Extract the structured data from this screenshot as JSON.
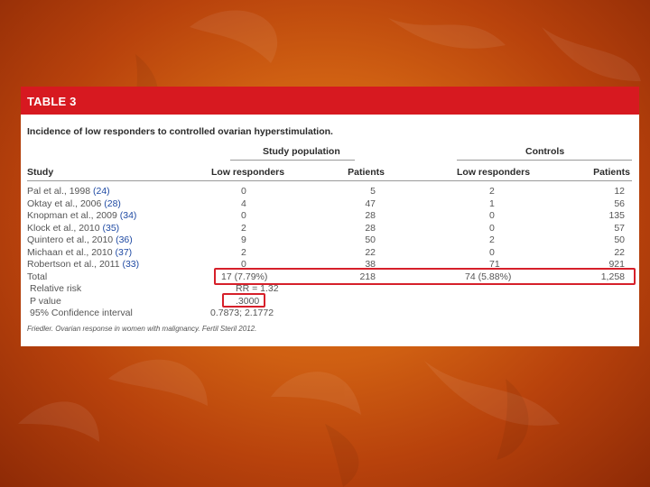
{
  "table": {
    "banner_title": "TABLE 3",
    "caption": "Incidence of low responders to controlled ovarian hyperstimulation.",
    "group_headers": {
      "study_population": "Study population",
      "controls": "Controls"
    },
    "columns": {
      "study": "Study",
      "low_responders": "Low responders",
      "patients": "Patients",
      "controls_low_responders": "Low responders",
      "controls_patients": "Patients"
    },
    "rows": [
      {
        "study": "Pal et al., 1998",
        "ref": "(24)",
        "low_responders": "0",
        "patients": "5",
        "controls_low_responders": "2",
        "controls_patients": "12"
      },
      {
        "study": "Oktay et al., 2006",
        "ref": "(28)",
        "low_responders": "4",
        "patients": "47",
        "controls_low_responders": "1",
        "controls_patients": "56"
      },
      {
        "study": "Knopman et al., 2009",
        "ref": "(34)",
        "low_responders": "0",
        "patients": "28",
        "controls_low_responders": "0",
        "controls_patients": "135"
      },
      {
        "study": "Klock et al., 2010",
        "ref": "(35)",
        "low_responders": "2",
        "patients": "28",
        "controls_low_responders": "0",
        "controls_patients": "57"
      },
      {
        "study": "Quintero et al., 2010",
        "ref": "(36)",
        "low_responders": "9",
        "patients": "50",
        "controls_low_responders": "2",
        "controls_patients": "50"
      },
      {
        "study": "Michaan et al., 2010",
        "ref": "(37)",
        "low_responders": "2",
        "patients": "22",
        "controls_low_responders": "0",
        "controls_patients": "22"
      },
      {
        "study": "Robertson et al., 2011",
        "ref": "(33)",
        "low_responders": "0",
        "patients": "38",
        "controls_low_responders": "71",
        "controls_patients": "921"
      }
    ],
    "total": {
      "label": "Total",
      "low_responders": "17 (7.79%)",
      "patients": "218",
      "controls_low_responders": "74 (5.88%)",
      "controls_patients": "1,258"
    },
    "stats": [
      {
        "label": "Relative risk",
        "value": "RR = 1.32"
      },
      {
        "label": "P value",
        "value": ".3000"
      },
      {
        "label": "95% Confidence interval",
        "value": "0.7873; 2.1772"
      }
    ],
    "footnote": "Friedler. Ovarian response in women with malignancy. Fertil Steril 2012."
  },
  "colors": {
    "banner": "#d71920",
    "highlight": "#d6202a",
    "reference_link": "#1f4aa3",
    "background_orange": "#cf5f12"
  }
}
